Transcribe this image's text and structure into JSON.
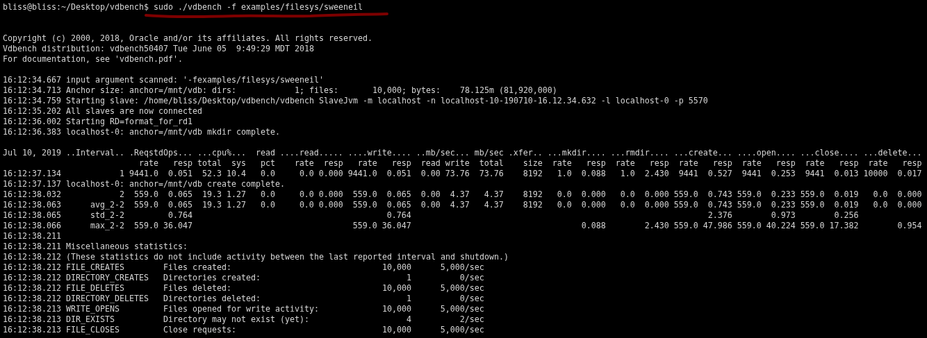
{
  "terminal": {
    "lines": [
      {
        "kind": "prompt",
        "prompt": "bliss@bliss:~/Desktop/vdbench$",
        "command": "sudo ./vdbench -f examples/filesys/sweeneil",
        "underlined": true
      },
      {
        "kind": "blank"
      },
      {
        "kind": "blank"
      },
      {
        "kind": "text",
        "text": "Copyright (c) 2000, 2018, Oracle and/or its affiliates. All rights reserved."
      },
      {
        "kind": "text",
        "text": "Vdbench distribution: vdbench50407 Tue June 05  9:49:29 MDT 2018"
      },
      {
        "kind": "text",
        "text": "For documentation, see 'vdbench.pdf'."
      },
      {
        "kind": "blank"
      },
      {
        "kind": "text",
        "text": "16:12:34.667 input argument scanned: '-fexamples/filesys/sweeneil'"
      },
      {
        "kind": "text",
        "text": "16:12:34.713 Anchor size: anchor=/mnt/vdb: dirs:            1; files:       10,000; bytes:    78.125m (81,920,000)"
      },
      {
        "kind": "text",
        "text": "16:12:34.759 Starting slave: /home/bliss/Desktop/vdbench/vdbench SlaveJvm -m localhost -n localhost-10-190710-16.12.34.632 -l localhost-0 -p 5570"
      },
      {
        "kind": "text",
        "text": "16:12:35.202 All slaves are now connected"
      },
      {
        "kind": "text",
        "text": "16:12:36.002 Starting RD=format_for_rd1"
      },
      {
        "kind": "text",
        "text": "16:12:36.383 localhost-0: anchor=/mnt/vdb mkdir complete."
      },
      {
        "kind": "blank"
      },
      {
        "kind": "group_header",
        "cells": {
          "time": "Jul 10, 2019",
          "interval": "..Interval..",
          "ops": ".ReqstdOps...",
          "cpu": "...cpu%...",
          "read_pct": "read",
          "read": "....read.....",
          "write": "....write....",
          "mb": "..mb/sec...",
          "mb_total": "mb/sec",
          "xfer": ".xfer..",
          "mkdir": "...mkdir....",
          "rmdir": "...rmdir....",
          "create": "...create...",
          "open": "....open....",
          "close": "...close....",
          "delete": "...delete..."
        }
      },
      {
        "kind": "sub_header",
        "cells": {
          "ops_rate": "rate",
          "ops_resp": "resp",
          "cpu_total": "total",
          "cpu_sys": "sys",
          "read_pct": "pct",
          "read_rate": "rate",
          "read_resp": "resp",
          "write_rate": "rate",
          "write_resp": "resp",
          "mb_read": "read",
          "mb_write": "write",
          "mb_total": "total",
          "xfer_size": "size",
          "mkdir_rate": "rate",
          "mkdir_resp": "resp",
          "rmdir_rate": "rate",
          "rmdir_resp": "resp",
          "create_rate": "rate",
          "create_resp": "resp",
          "open_rate": "rate",
          "open_resp": "resp",
          "close_rate": "rate",
          "close_resp": "resp",
          "delete_rate": "rate",
          "delete_resp": "resp"
        }
      },
      {
        "kind": "row",
        "cells": {
          "time": "16:12:37.134",
          "interval": "1",
          "ops_rate": "9441.0",
          "ops_resp": "0.051",
          "cpu_total": "52.3",
          "cpu_sys": "10.4",
          "read_pct": "0.0",
          "read_rate": "0.0",
          "read_resp": "0.000",
          "write_rate": "9441.0",
          "write_resp": "0.051",
          "mb_read": "0.00",
          "mb_write": "73.76",
          "mb_total": "73.76",
          "xfer_size": "8192",
          "mkdir_rate": "1.0",
          "mkdir_resp": "0.088",
          "rmdir_rate": "1.0",
          "rmdir_resp": "2.430",
          "create_rate": "9441",
          "create_resp": "0.527",
          "open_rate": "9441",
          "open_resp": "0.253",
          "close_rate": "9441",
          "close_resp": "0.013",
          "delete_rate": "10000",
          "delete_resp": "0.017"
        }
      },
      {
        "kind": "text",
        "text": "16:12:37.137 localhost-0: anchor=/mnt/vdb create complete."
      },
      {
        "kind": "row",
        "cells": {
          "time": "16:12:38.032",
          "interval": "2",
          "ops_rate": "559.0",
          "ops_resp": "0.065",
          "cpu_total": "19.3",
          "cpu_sys": "1.27",
          "read_pct": "0.0",
          "read_rate": "0.0",
          "read_resp": "0.000",
          "write_rate": "559.0",
          "write_resp": "0.065",
          "mb_read": "0.00",
          "mb_write": "4.37",
          "mb_total": "4.37",
          "xfer_size": "8192",
          "mkdir_rate": "0.0",
          "mkdir_resp": "0.000",
          "rmdir_rate": "0.0",
          "rmdir_resp": "0.000",
          "create_rate": "559.0",
          "create_resp": "0.743",
          "open_rate": "559.0",
          "open_resp": "0.233",
          "close_rate": "559.0",
          "close_resp": "0.019",
          "delete_rate": "0.0",
          "delete_resp": "0.000"
        }
      },
      {
        "kind": "row",
        "cells": {
          "time": "16:12:38.063",
          "interval": "avg_2-2",
          "ops_rate": "559.0",
          "ops_resp": "0.065",
          "cpu_total": "19.3",
          "cpu_sys": "1.27",
          "read_pct": "0.0",
          "read_rate": "0.0",
          "read_resp": "0.000",
          "write_rate": "559.0",
          "write_resp": "0.065",
          "mb_read": "0.00",
          "mb_write": "4.37",
          "mb_total": "4.37",
          "xfer_size": "8192",
          "mkdir_rate": "0.0",
          "mkdir_resp": "0.000",
          "rmdir_rate": "0.0",
          "rmdir_resp": "0.000",
          "create_rate": "559.0",
          "create_resp": "0.743",
          "open_rate": "559.0",
          "open_resp": "0.233",
          "close_rate": "559.0",
          "close_resp": "0.019",
          "delete_rate": "0.0",
          "delete_resp": "0.000"
        }
      },
      {
        "kind": "row",
        "cells": {
          "time": "16:12:38.065",
          "interval": "std_2-2",
          "ops_resp": "0.764",
          "write_resp": "0.764",
          "create_resp": "2.376",
          "open_resp": "0.973",
          "close_resp": "0.256"
        }
      },
      {
        "kind": "row",
        "cells": {
          "time": "16:12:38.066",
          "interval": "max_2-2",
          "ops_rate": "559.0",
          "ops_resp": "36.047",
          "write_rate": "559.0",
          "write_resp": "36.047",
          "mkdir_resp": "0.088",
          "rmdir_resp": "2.430",
          "create_rate": "559.0",
          "create_resp": "47.986",
          "open_rate": "559.0",
          "open_resp": "40.224",
          "close_rate": "559.0",
          "close_resp": "17.382",
          "delete_resp": "0.954"
        }
      },
      {
        "kind": "text",
        "text": "16:12:38.211"
      },
      {
        "kind": "text",
        "text": "16:12:38.211 Miscellaneous statistics:"
      },
      {
        "kind": "text",
        "text": "16:12:38.212 (These statistics do not include activity between the last reported interval and shutdown.)"
      },
      {
        "kind": "stat",
        "time": "16:12:38.212",
        "counter": "FILE_CREATES",
        "description": "Files created:",
        "count": "10,000",
        "rate": "5,000/sec"
      },
      {
        "kind": "stat",
        "time": "16:12:38.212",
        "counter": "DIRECTORY_CREATES",
        "description": "Directories created:",
        "count": "1",
        "rate": "0/sec"
      },
      {
        "kind": "stat",
        "time": "16:12:38.212",
        "counter": "FILE_DELETES",
        "description": "Files deleted:",
        "count": "10,000",
        "rate": "5,000/sec"
      },
      {
        "kind": "stat",
        "time": "16:12:38.212",
        "counter": "DIRECTORY_DELETES",
        "description": "Directories deleted:",
        "count": "1",
        "rate": "0/sec"
      },
      {
        "kind": "stat",
        "time": "16:12:38.213",
        "counter": "WRITE_OPENS",
        "description": "Files opened for write activity:",
        "count": "10,000",
        "rate": "5,000/sec"
      },
      {
        "kind": "stat",
        "time": "16:12:38.213",
        "counter": "DIR_EXISTS",
        "description": "Directory may not exist (yet):",
        "count": "4",
        "rate": "2/sec"
      },
      {
        "kind": "stat",
        "time": "16:12:38.213",
        "counter": "FILE_CLOSES",
        "description": "Close requests:",
        "count": "10,000",
        "rate": "5,000/sec"
      }
    ]
  }
}
